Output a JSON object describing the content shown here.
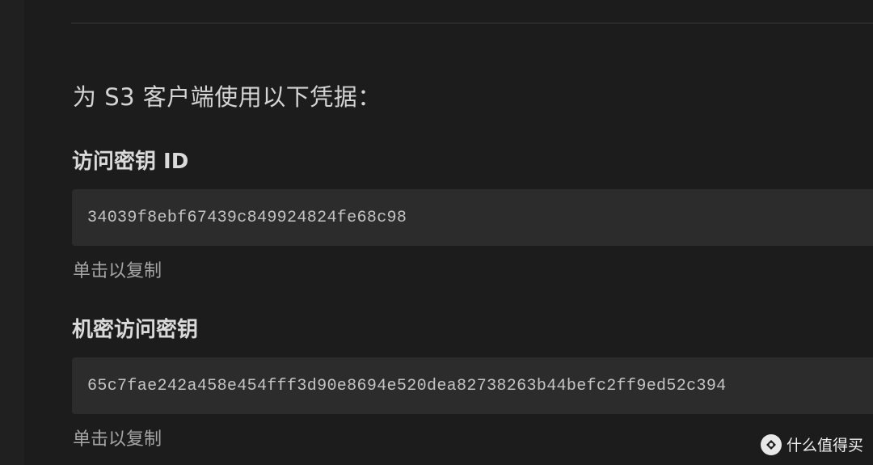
{
  "intro_text": "为 S3 客户端使用以下凭据：",
  "access_key": {
    "label": "访问密钥 ID",
    "value": "34039f8ebf67439c849924824fe68c98",
    "copy_hint": "单击以复制"
  },
  "secret_key": {
    "label": "机密访问密钥",
    "value": "65c7fae242a458e454fff3d90e8694e520dea82738263b44befc2ff9ed52c394",
    "copy_hint": "单击以复制"
  },
  "watermark": {
    "logo_icon": "zhi-logo-icon",
    "text": "什么值得买"
  }
}
